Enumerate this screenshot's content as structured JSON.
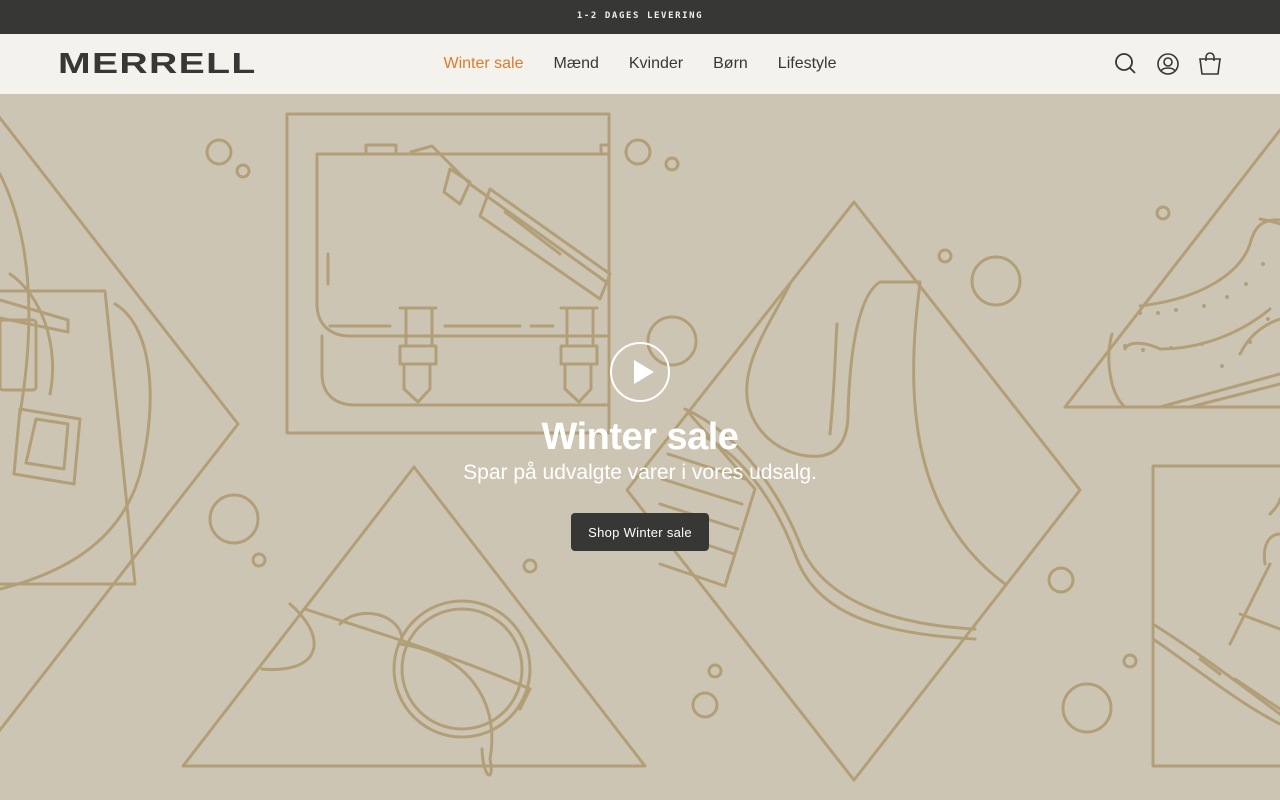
{
  "announcement": {
    "text": "1-2 DAGES LEVERING"
  },
  "header": {
    "logo": "MERRELL",
    "nav": [
      {
        "label": "Winter sale"
      },
      {
        "label": "Mænd"
      },
      {
        "label": "Kvinder"
      },
      {
        "label": "Børn"
      },
      {
        "label": "Lifestyle"
      }
    ],
    "icons": [
      "search-icon",
      "account-icon",
      "cart-icon"
    ]
  },
  "hero": {
    "title": "Winter sale",
    "subtitle": "Spar på udvalgte varer i vores udsalg.",
    "cta_label": "Shop Winter sale"
  },
  "colors": {
    "announcement_bg": "#373735",
    "header_bg": "#f4f2ec",
    "hero_bg": "#cdc5b3",
    "line_art": "#b29f78",
    "accent": "#e07a2e"
  }
}
